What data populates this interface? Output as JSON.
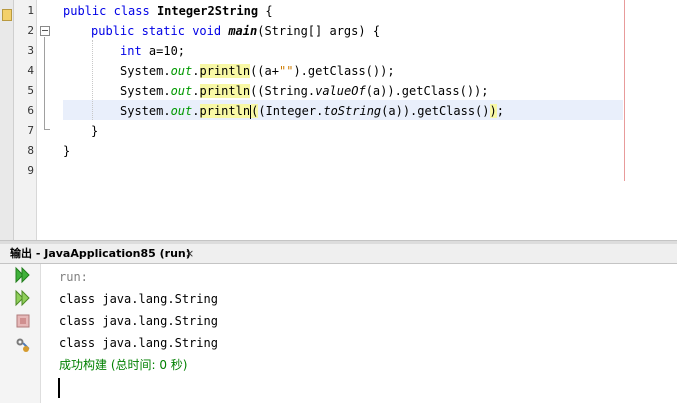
{
  "editor": {
    "line_numbers": [
      "1",
      "2",
      "3",
      "4",
      "5",
      "6",
      "7",
      "8",
      "9"
    ],
    "code": {
      "l1": {
        "kw1": "public",
        "kw2": "class",
        "name": "Integer2String",
        "rest": " {"
      },
      "l2": {
        "kw1": "public",
        "kw2": "static",
        "kw3": "void",
        "method": "main",
        "rest": "(String[] args) {"
      },
      "l3": {
        "kw1": "int",
        "rest": " a=10;"
      },
      "l4": {
        "p1": "System.",
        "field": "out",
        "p2": ".",
        "call": "println",
        "p3": "((a+",
        "str": "\"\"",
        "p4": ").getClass());"
      },
      "l5": {
        "p1": "System.",
        "field": "out",
        "p2": ".",
        "call": "println",
        "p3": "((String.",
        "it": "valueOf",
        "p4": "(a)).getClass());"
      },
      "l6": {
        "p1": "System.",
        "field": "out",
        "p2": ".",
        "call": "println",
        "p3": "(",
        "p4": "(Integer.",
        "it": "toString",
        "p5": "(a)).getClass()",
        "p6": ")",
        ";": ";"
      },
      "l7": {
        "rest": "}"
      },
      "l8": {
        "rest": "}"
      }
    }
  },
  "output_panel": {
    "tab_title": "输出 - JavaApplication85 (run)",
    "close_label": "×",
    "lines": {
      "run": "run:",
      "o1": "class java.lang.String",
      "o2": "class java.lang.String",
      "o3": "class java.lang.String",
      "success": "成功构建 (总时间: 0 秒)"
    },
    "toolbar_icons": [
      "rerun-icon",
      "rerun-with-options-icon",
      "stop-icon",
      "settings-icon"
    ]
  }
}
